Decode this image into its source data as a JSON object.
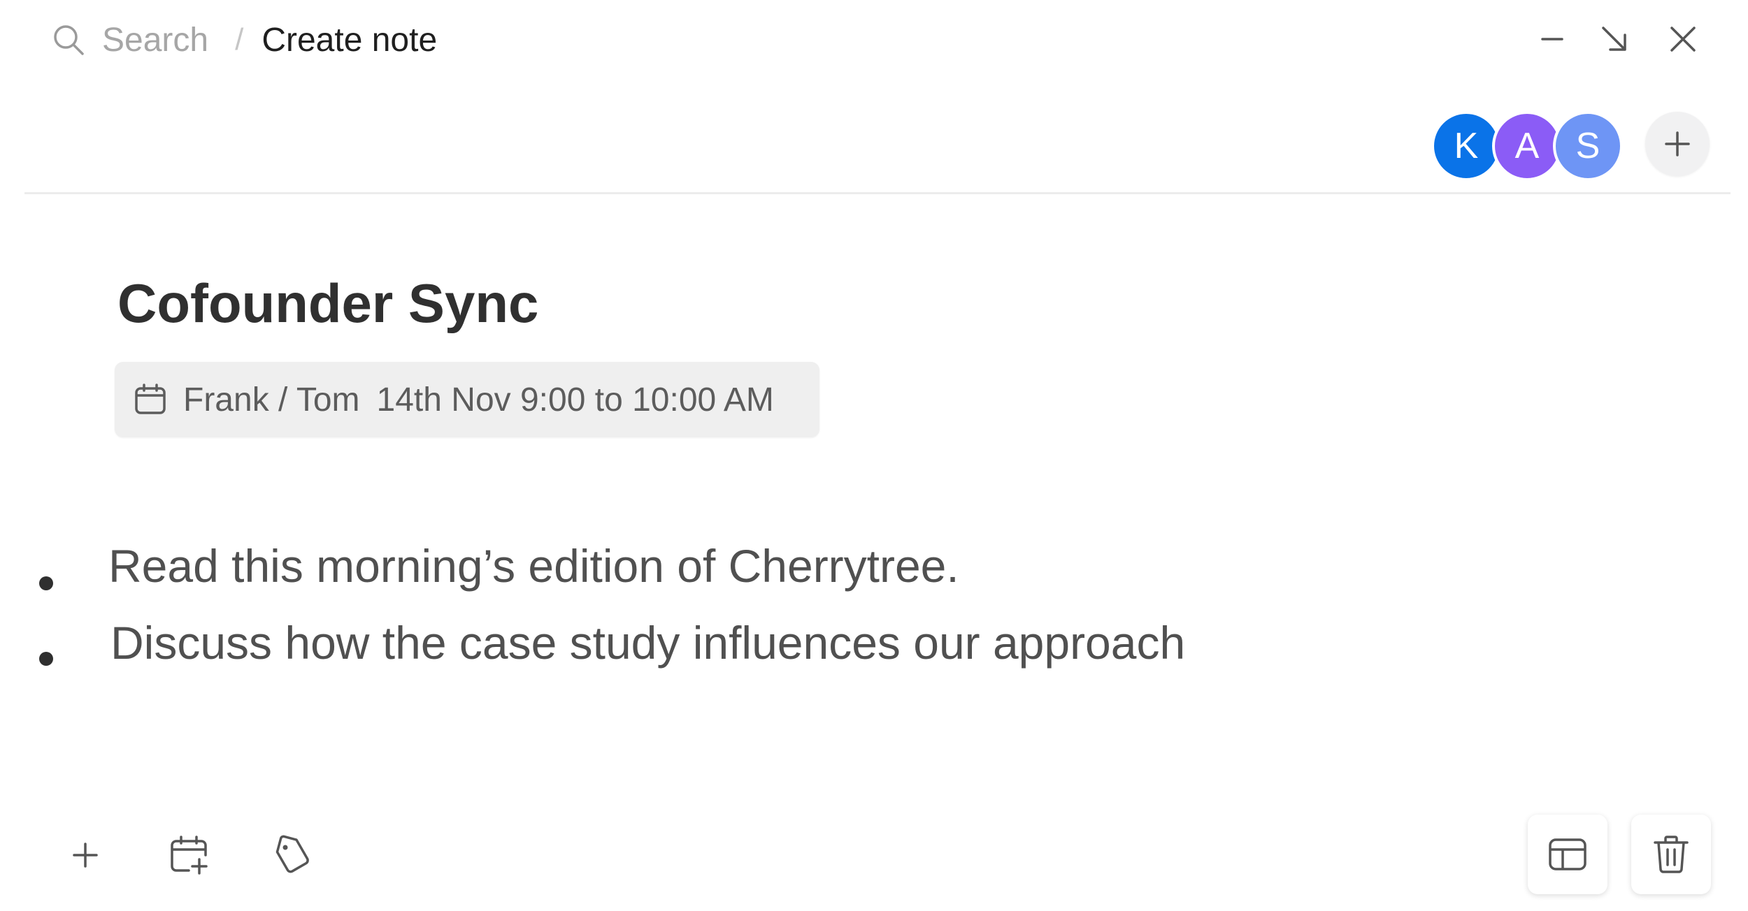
{
  "breadcrumb": {
    "search_label": "Search",
    "separator": "/",
    "current": "Create note"
  },
  "window_controls": {
    "icons": [
      "minimize-icon",
      "collapse-arrow-icon",
      "close-icon"
    ]
  },
  "collaborators": [
    {
      "initial": "K",
      "color": "#0a73e8"
    },
    {
      "initial": "A",
      "color": "#8b5cf6"
    },
    {
      "initial": "S",
      "color": "#6e95f5"
    }
  ],
  "note": {
    "title": "Cofounder Sync",
    "event": {
      "participants": "Frank / Tom",
      "datetime": "14th Nov 9:00 to 10:00 AM"
    },
    "bullets": [
      "Read this morning’s edition of Cherrytree.",
      "Discuss how the case study influences our approach"
    ]
  },
  "toolbar": {
    "left_icons": [
      "plus-icon",
      "calendar-add-icon",
      "tag-icon"
    ],
    "right_icons": [
      "layout-icon",
      "trash-icon"
    ]
  }
}
